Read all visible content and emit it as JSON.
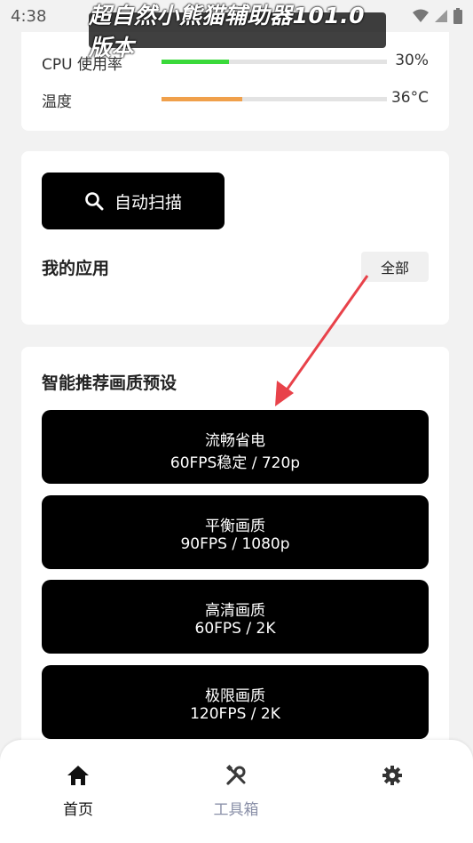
{
  "status_bar": {
    "time": "4:38"
  },
  "overlay_title": "超自然小熊猫辅助器101.0版本",
  "monitor": {
    "cpu": {
      "label": "CPU 使用率",
      "value_text": "30%",
      "level": 0.3,
      "color": "#3ad93a"
    },
    "temp": {
      "label": "温度",
      "value_text": "36°C",
      "level": 0.36,
      "color": "#f0a04b"
    }
  },
  "apps": {
    "scan_label": "自动扫描",
    "title": "我的应用",
    "filter_label": "全部"
  },
  "presets": {
    "title": "智能推荐画质预设",
    "items": [
      {
        "name": "流畅省电",
        "detail": "60FPS稳定 / 720p"
      },
      {
        "name": "平衡画质",
        "detail": "90FPS / 1080p"
      },
      {
        "name": "高清画质",
        "detail": "60FPS / 2K"
      },
      {
        "name": "极限画质",
        "detail": "120FPS / 2K"
      }
    ]
  },
  "nav": {
    "home": {
      "label": "首页",
      "icon": "home-icon"
    },
    "tools": {
      "label": "工具箱",
      "icon": "tools-icon"
    },
    "settings": {
      "icon": "gear-icon"
    }
  },
  "colors": {
    "accent_arrow": "#e8424a",
    "nav_inactive": "#8a90a8"
  }
}
